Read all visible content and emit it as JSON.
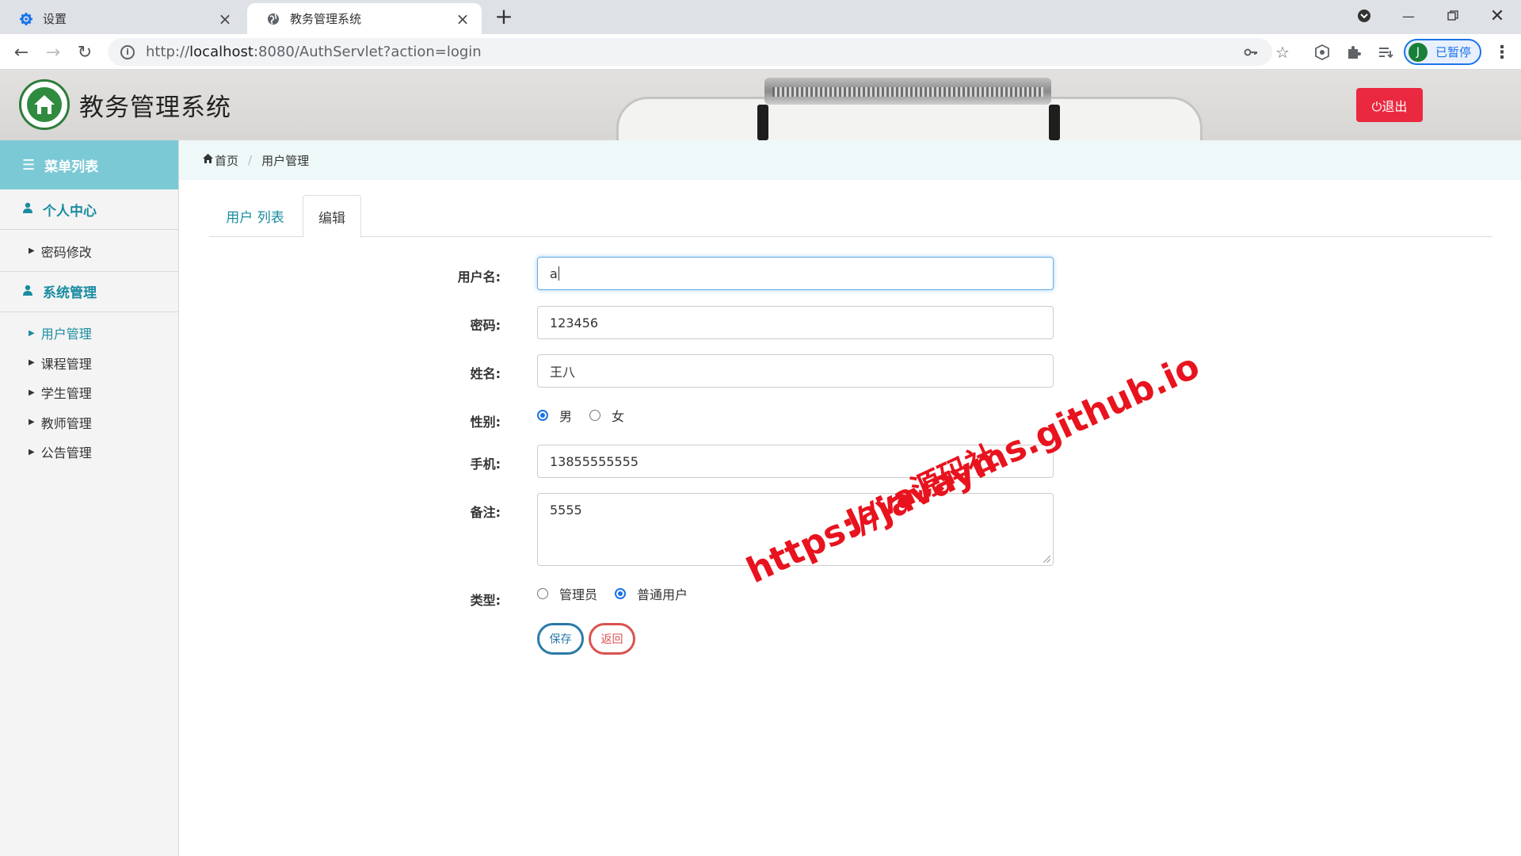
{
  "browser": {
    "tabs": [
      {
        "title": "设置",
        "icon": "gear-icon"
      },
      {
        "title": "教务管理系统",
        "icon": "globe-icon"
      }
    ],
    "url_scheme": "http://",
    "url_host": "localhost",
    "url_rest": ":8080/AuthServlet?action=login",
    "profile_initial": "J",
    "profile_status": "已暂停"
  },
  "header": {
    "title": "教务管理系统",
    "logout_label": "⏻退出",
    "brand_color": "#2e8b3f",
    "logout_color": "#ea2940"
  },
  "sidebar": {
    "menu_title": "菜单列表",
    "groups": [
      {
        "title": "个人中心",
        "items": [
          "密码修改"
        ]
      },
      {
        "title": "系统管理",
        "items": [
          "用户管理",
          "课程管理",
          "学生管理",
          "教师管理",
          "公告管理"
        ]
      }
    ],
    "active_item": "用户管理"
  },
  "breadcrumb": {
    "home": "首页",
    "current": "用户管理"
  },
  "tabs": {
    "list": "用户 列表",
    "edit": "编辑"
  },
  "form": {
    "username": {
      "label": "用户名:",
      "value": "a"
    },
    "password": {
      "label": "密码:",
      "value": "123456"
    },
    "name": {
      "label": "姓名:",
      "value": "王八"
    },
    "gender": {
      "label": "性别:",
      "options": [
        "男",
        "女"
      ],
      "selected": "男"
    },
    "phone": {
      "label": "手机:",
      "value": "13855555555"
    },
    "remark": {
      "label": "备注:",
      "value": "5555"
    },
    "type": {
      "label": "类型:",
      "options": [
        "管理员",
        "普通用户"
      ],
      "selected": "普通用户"
    },
    "save_label": "保存",
    "back_label": "返回"
  },
  "watermark": {
    "line1": "Java源码社",
    "line2": "https://javayms.github.io"
  }
}
